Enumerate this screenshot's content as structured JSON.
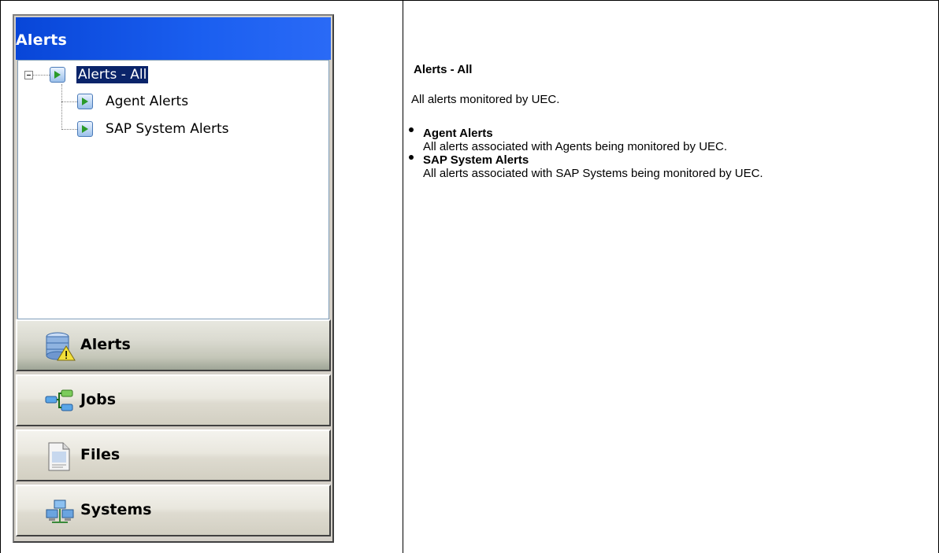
{
  "navigator": {
    "title": "Alerts",
    "tree": {
      "root": "Alerts - All",
      "children": [
        "Agent Alerts",
        "SAP System Alerts"
      ]
    },
    "buttons": [
      {
        "label": "Alerts",
        "icon": "alerts-database-icon",
        "active": true
      },
      {
        "label": "Jobs",
        "icon": "jobs-network-icon",
        "active": false
      },
      {
        "label": "Files",
        "icon": "files-document-icon",
        "active": false
      },
      {
        "label": "Systems",
        "icon": "systems-computers-icon",
        "active": false
      }
    ]
  },
  "content": {
    "title": "Alerts - All",
    "description": "All alerts monitored by UEC.",
    "items": [
      {
        "title": "Agent Alerts",
        "description": "All alerts associated with Agents being monitored by UEC."
      },
      {
        "title": "SAP System Alerts",
        "description": "All alerts associated with SAP Systems being monitored by UEC."
      }
    ]
  },
  "colors": {
    "header": "#0a4ce0",
    "selection": "#0a246a",
    "panel": "#d4d0c8"
  }
}
